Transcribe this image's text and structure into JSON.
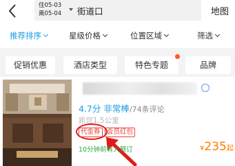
{
  "header": {
    "check_in": "住05-03",
    "check_out": "离05-04",
    "location": "街道口",
    "map_label": "地图"
  },
  "filters": [
    {
      "label": "推荐排序",
      "active": true
    },
    {
      "label": "星级价格",
      "active": false
    },
    {
      "label": "位置区域",
      "active": false
    },
    {
      "label": "筛选",
      "active": false
    }
  ],
  "tags": [
    {
      "label": "促销优惠"
    },
    {
      "label": "酒店类型"
    },
    {
      "label": "特色专题",
      "has_dot": true
    },
    {
      "label": "品牌"
    }
  ],
  "hotel": {
    "score": "4.7分",
    "rating_word": "非常棒",
    "reviews": "/74条评论",
    "distance": "距您1.5公里",
    "promo_tags": [
      "代金券",
      "会员红包"
    ],
    "booking_note": "10分钟前有人预订",
    "price_currency": "¥",
    "price": "235",
    "price_suffix": "起"
  },
  "colors": {
    "accent": "#1a9de3",
    "promo": "#e8423a",
    "price": "#ff7a00",
    "note": "#24a63a",
    "annotation": "#e01a1a"
  },
  "icons": {
    "back": "chevron-left-icon",
    "date_caret": "caret-down-icon",
    "filter_chevron": "chevron-down-icon",
    "hotel_badge": "verified-icon",
    "annotation_arrow": "arrow-icon"
  }
}
